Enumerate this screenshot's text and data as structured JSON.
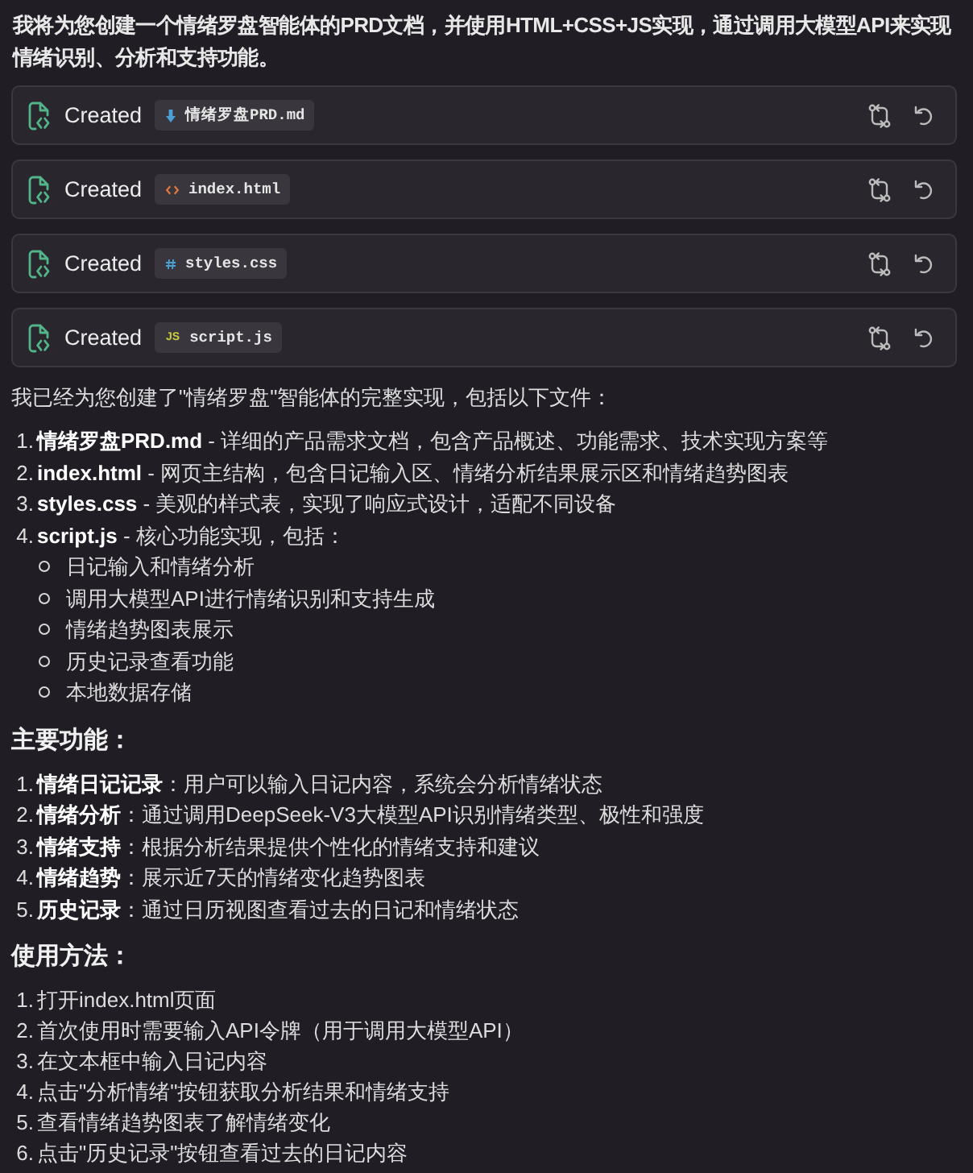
{
  "intro": "我将为您创建一个情绪罗盘智能体的PRD文档，并使用HTML+CSS+JS实现，通过调用大模型API来实现情绪识别、分析和支持功能。",
  "file_actions": [
    {
      "status": "Created",
      "file": {
        "kind": "md",
        "name": "情绪罗盘PRD.md"
      }
    },
    {
      "status": "Created",
      "file": {
        "kind": "html",
        "name": "index.html"
      }
    },
    {
      "status": "Created",
      "file": {
        "kind": "css",
        "name": "styles.css"
      }
    },
    {
      "status": "Created",
      "file": {
        "kind": "js",
        "name": "script.js",
        "badge": "JS"
      }
    }
  ],
  "summary": "我已经为您创建了\"情绪罗盘\"智能体的完整实现，包括以下文件：",
  "file_list": [
    {
      "number": "1.",
      "text": "**情绪罗盘PRD.md** - 详细的产品需求文档，包含产品概述、功能需求、技术实现方案等"
    },
    {
      "number": "2.",
      "text": "**index.html** - 网页主结构，包含日记输入区、情绪分析结果展示区和情绪趋势图表"
    },
    {
      "number": "3.",
      "text": "**styles.css** - 美观的样式表，实现了响应式设计，适配不同设备"
    },
    {
      "number": "4.",
      "text": "**script.js** - 核心功能实现，包括：",
      "children": [
        {
          "text": "日记输入和情绪分析"
        },
        {
          "text": "调用大模型API进行情绪识别和支持生成"
        },
        {
          "text": "情绪趋势图表展示"
        },
        {
          "text": "历史记录查看功能"
        },
        {
          "text": "本地数据存储"
        }
      ]
    }
  ],
  "sections": [
    {
      "heading": "主要功能：",
      "items": [
        {
          "number": "1.",
          "text": "**情绪日记记录**：用户可以输入日记内容，系统会分析情绪状态"
        },
        {
          "number": "2.",
          "text": "**情绪分析**：通过调用DeepSeek-V3大模型API识别情绪类型、极性和强度"
        },
        {
          "number": "3.",
          "text": "**情绪支持**：根据分析结果提供个性化的情绪支持和建议"
        },
        {
          "number": "4.",
          "text": "**情绪趋势**：展示近7天的情绪变化趋势图表"
        },
        {
          "number": "5.",
          "text": "**历史记录**：通过日历视图查看过去的日记和情绪状态"
        }
      ]
    },
    {
      "heading": "使用方法：",
      "items": [
        {
          "number": "1.",
          "text": "打开index.html页面"
        },
        {
          "number": "2.",
          "text": "首次使用时需要输入API令牌（用于调用大模型API）"
        },
        {
          "number": "3.",
          "text": "在文本框中输入日记内容"
        },
        {
          "number": "4.",
          "text": "点击\"分析情绪\"按钮获取分析结果和情绪支持"
        },
        {
          "number": "5.",
          "text": "查看情绪趋势图表了解情绪变化"
        },
        {
          "number": "6.",
          "text": "点击\"历史记录\"按钮查看过去的日记内容"
        }
      ]
    }
  ]
}
